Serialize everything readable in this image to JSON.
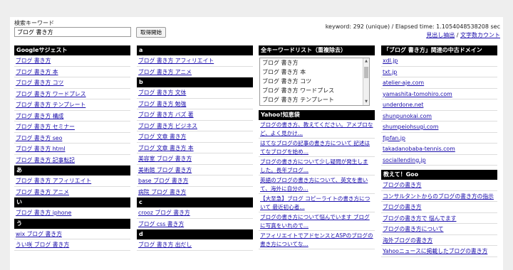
{
  "search": {
    "label": "検索キーワード",
    "value": "ブログ 書き方",
    "button": "取得開始"
  },
  "status": {
    "keyword_info": "keyword: 292 (unique) / Elapsed time: 1.1054048538208 sec",
    "link1": "見出し抽出",
    "separator": " / ",
    "link2": "文字数カウント"
  },
  "col1": {
    "header": "Googleサジェスト",
    "items": [
      "ブログ 書き方",
      "ブログ 書き方 本",
      "ブログ 書き方 コツ",
      "ブログ 書き方 ワードプレス",
      "ブログ 書き方 テンプレート",
      "ブログ 書き方 構成",
      "ブログ 書き方 セミナー",
      "ブログ 書き方 seo",
      "ブログ 書き方 html",
      "ブログ 書き方 記事転記"
    ],
    "section_a": "あ",
    "items_a": [
      "ブログ 書き方 アフィリエイト",
      "ブログ 書き方 アニメ"
    ],
    "section_i": "い",
    "items_i": [
      "ブログ 書き方 iphone"
    ],
    "section_u": "う",
    "items_u": [
      "wix ブログ 書き方",
      "うい咲 ブログ 書き方"
    ]
  },
  "col2": {
    "header_a": "a",
    "items_a": [
      "ブログ 書き方 アフィリエイト",
      "ブログ 書き方 アニメ"
    ],
    "header_b": "b",
    "items_b": [
      "ブログ 書き方 文体",
      "ブログ 書き方 勉強",
      "ブログ 書き方 バズ 著",
      "ブログ 書き方 ビジネス",
      "ブログ 文章 書き方",
      "ブログ 文章 書き方 本",
      "美容室 ブログ 書き方",
      "美術館 ブログ 書き方",
      "base ブログ 書き方",
      "病院 ブログ 書き方"
    ],
    "header_c": "c",
    "items_c": [
      "crooz ブログ 書き方",
      "ブログ css 書き方"
    ],
    "header_d": "d",
    "items_d": [
      "ブログ 書き方 出だし"
    ]
  },
  "col3": {
    "header": "全キーワードリスト（重複除去）",
    "list": [
      "ブログ 書き方",
      "ブログ 書き方 本",
      "ブログ 書き方 コツ",
      "ブログ 書き方 ワードプレス",
      "ブログ 書き方 テンプレート"
    ],
    "yahoo_header": "Yahoo!知恵袋",
    "yahoo_items": [
      "ブログの書き方、教えてください。アメブロなど、よく見かけ...",
      "はてなブログの記事の書き方について 記述はてなブログを始め...",
      "ブログの書き方について少し疑問が発生しました。長年ブログ...",
      "英語のブログの書き方について、英文を書いて、海外に自分の...",
      "【大至急】ブログ コピーライトの書き方について 最近初心者...",
      "ブログの書き方について悩んでいます ブログに写真をいれので...",
      "アフィリエイトでアドセンスとASPのブログの書き方についてな..."
    ]
  },
  "col4": {
    "header": "「ブログ 書き方」関連の中古ドメイン",
    "domains": [
      "xdl.jp",
      "txt.jp",
      "atelier-aje.com",
      "yamashita-tomohiro.com",
      "underdone.net",
      "shunpunokai.com",
      "shumpeiohsugi.com",
      "fjpfan.jp",
      "takadanobaba-tennis.com",
      "sociallending.jp"
    ],
    "goo_header": "教えて！Goo",
    "goo_items": [
      "ブログの書き方",
      "コンサルタントからのブログの書き方の指示",
      "ブログの書き方",
      "ブログの書き方で 悩んでます",
      "ブログの書き方について",
      "海外ブログの書き方",
      "Yahooニュースに掲載したブログの書き方"
    ]
  }
}
